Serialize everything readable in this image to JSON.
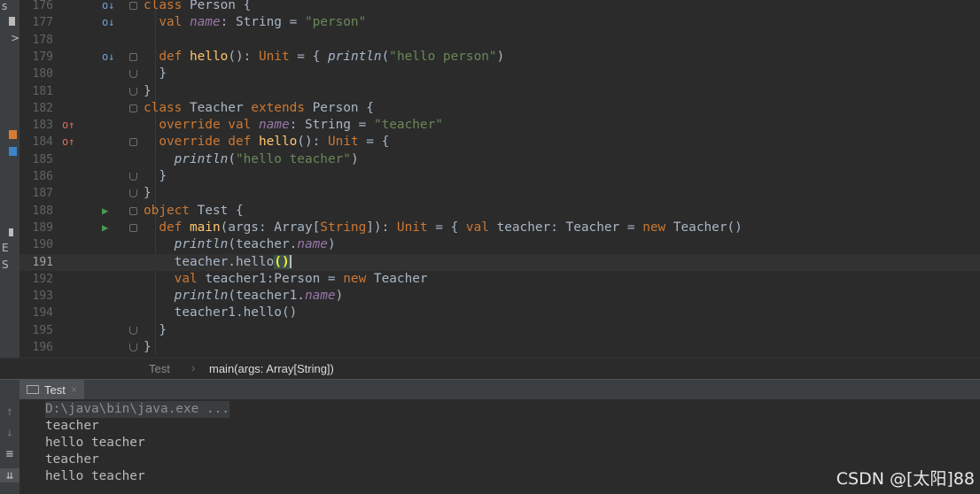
{
  "editor": {
    "lines": [
      {
        "num": "176",
        "gutter": "o↓",
        "tokens": [
          {
            "t": "class ",
            "c": "kw"
          },
          {
            "t": "Person {",
            "c": ""
          }
        ]
      },
      {
        "num": "177",
        "gutter": "o↓",
        "tokens": [
          {
            "t": "  val ",
            "c": "kw"
          },
          {
            "t": "name",
            "c": "fld"
          },
          {
            "t": ": String = ",
            "c": ""
          },
          {
            "t": "\"person\"",
            "c": "str"
          }
        ]
      },
      {
        "num": "178",
        "gutter": "",
        "tokens": []
      },
      {
        "num": "179",
        "gutter": "o↓",
        "tokens": [
          {
            "t": "  def ",
            "c": "kw"
          },
          {
            "t": "hello",
            "c": "fn"
          },
          {
            "t": "(): ",
            "c": ""
          },
          {
            "t": "Unit",
            "c": "kw"
          },
          {
            "t": " = { ",
            "c": ""
          },
          {
            "t": "println",
            "c": "it"
          },
          {
            "t": "(",
            "c": ""
          },
          {
            "t": "\"hello person\"",
            "c": "str"
          },
          {
            "t": ")",
            "c": ""
          }
        ]
      },
      {
        "num": "180",
        "gutter": "",
        "tokens": [
          {
            "t": "  }",
            "c": ""
          }
        ]
      },
      {
        "num": "181",
        "gutter": "",
        "tokens": [
          {
            "t": "}",
            "c": ""
          }
        ]
      },
      {
        "num": "182",
        "gutter": "",
        "tokens": [
          {
            "t": "class ",
            "c": "kw"
          },
          {
            "t": "Teacher ",
            "c": ""
          },
          {
            "t": "extends ",
            "c": "kw"
          },
          {
            "t": "Person {",
            "c": ""
          }
        ]
      },
      {
        "num": "183",
        "gutter": "o↑",
        "tokens": [
          {
            "t": "  override val ",
            "c": "kw"
          },
          {
            "t": "name",
            "c": "fld"
          },
          {
            "t": ": String = ",
            "c": ""
          },
          {
            "t": "\"teacher\"",
            "c": "str"
          }
        ]
      },
      {
        "num": "184",
        "gutter": "o↑",
        "tokens": [
          {
            "t": "  override def ",
            "c": "kw"
          },
          {
            "t": "hello",
            "c": "fn"
          },
          {
            "t": "(): ",
            "c": ""
          },
          {
            "t": "Unit",
            "c": "kw"
          },
          {
            "t": " = {",
            "c": ""
          }
        ]
      },
      {
        "num": "185",
        "gutter": "",
        "tokens": [
          {
            "t": "    ",
            "c": ""
          },
          {
            "t": "println",
            "c": "it"
          },
          {
            "t": "(",
            "c": ""
          },
          {
            "t": "\"hello teacher\"",
            "c": "str"
          },
          {
            "t": ")",
            "c": ""
          }
        ]
      },
      {
        "num": "186",
        "gutter": "",
        "tokens": [
          {
            "t": "  }",
            "c": ""
          }
        ]
      },
      {
        "num": "187",
        "gutter": "",
        "tokens": [
          {
            "t": "}",
            "c": ""
          }
        ]
      },
      {
        "num": "188",
        "gutter": "▶",
        "tokens": [
          {
            "t": "object ",
            "c": "kw"
          },
          {
            "t": "Test {",
            "c": ""
          }
        ]
      },
      {
        "num": "189",
        "gutter": "▶",
        "tokens": [
          {
            "t": "  def ",
            "c": "kw"
          },
          {
            "t": "main",
            "c": "fn"
          },
          {
            "t": "(args: Array[",
            "c": ""
          },
          {
            "t": "String",
            "c": "kw"
          },
          {
            "t": "]): ",
            "c": ""
          },
          {
            "t": "Unit",
            "c": "kw"
          },
          {
            "t": " = { ",
            "c": ""
          },
          {
            "t": "val ",
            "c": "kw"
          },
          {
            "t": "teacher: Teacher = ",
            "c": ""
          },
          {
            "t": "new ",
            "c": "kw"
          },
          {
            "t": "Teacher()",
            "c": ""
          }
        ]
      },
      {
        "num": "190",
        "gutter": "",
        "tokens": [
          {
            "t": "    ",
            "c": ""
          },
          {
            "t": "println",
            "c": "it"
          },
          {
            "t": "(teacher.",
            "c": ""
          },
          {
            "t": "name",
            "c": "fld"
          },
          {
            "t": ")",
            "c": ""
          }
        ]
      },
      {
        "num": "191",
        "gutter": "",
        "tokens": [
          {
            "t": "    teacher.hello",
            "c": ""
          },
          {
            "t": "()",
            "c": "brace-hl"
          }
        ]
      },
      {
        "num": "192",
        "gutter": "",
        "tokens": [
          {
            "t": "    val ",
            "c": "kw"
          },
          {
            "t": "teacher1:Person = ",
            "c": ""
          },
          {
            "t": "new ",
            "c": "kw"
          },
          {
            "t": "Teacher",
            "c": ""
          }
        ]
      },
      {
        "num": "193",
        "gutter": "",
        "tokens": [
          {
            "t": "    ",
            "c": ""
          },
          {
            "t": "println",
            "c": "it"
          },
          {
            "t": "(teacher1.",
            "c": ""
          },
          {
            "t": "name",
            "c": "fld"
          },
          {
            "t": ")",
            "c": ""
          }
        ]
      },
      {
        "num": "194",
        "gutter": "",
        "tokens": [
          {
            "t": "    teacher1.hello()",
            "c": ""
          }
        ]
      },
      {
        "num": "195",
        "gutter": "",
        "tokens": [
          {
            "t": "  }",
            "c": ""
          }
        ]
      },
      {
        "num": "196",
        "gutter": "",
        "tokens": [
          {
            "t": "}",
            "c": ""
          }
        ]
      }
    ],
    "current_line": "191"
  },
  "breadcrumb": {
    "item1": "Test",
    "separator": "›",
    "item2": "main(args: Array[String])"
  },
  "run_panel": {
    "tab_label": "Test",
    "tab_close": "×",
    "output": [
      "D:\\java\\bin\\java.exe ...",
      "teacher",
      "hello teacher",
      "teacher",
      "hello teacher"
    ]
  },
  "left_strip": [
    "s",
    "",
    ">",
    "",
    "",
    "",
    "",
    "",
    "E",
    "S"
  ],
  "watermark": "CSDN @[太阳]88",
  "colors": {
    "keyword": "#cc7832",
    "string": "#6a8759",
    "field": "#9876aa",
    "function": "#ffc66d",
    "text": "#a9b7c6",
    "background": "#2b2b2b"
  },
  "icons": {
    "override": "override-arrow-icon",
    "implemented": "implemented-arrow-icon",
    "run": "run-triangle-icon"
  }
}
